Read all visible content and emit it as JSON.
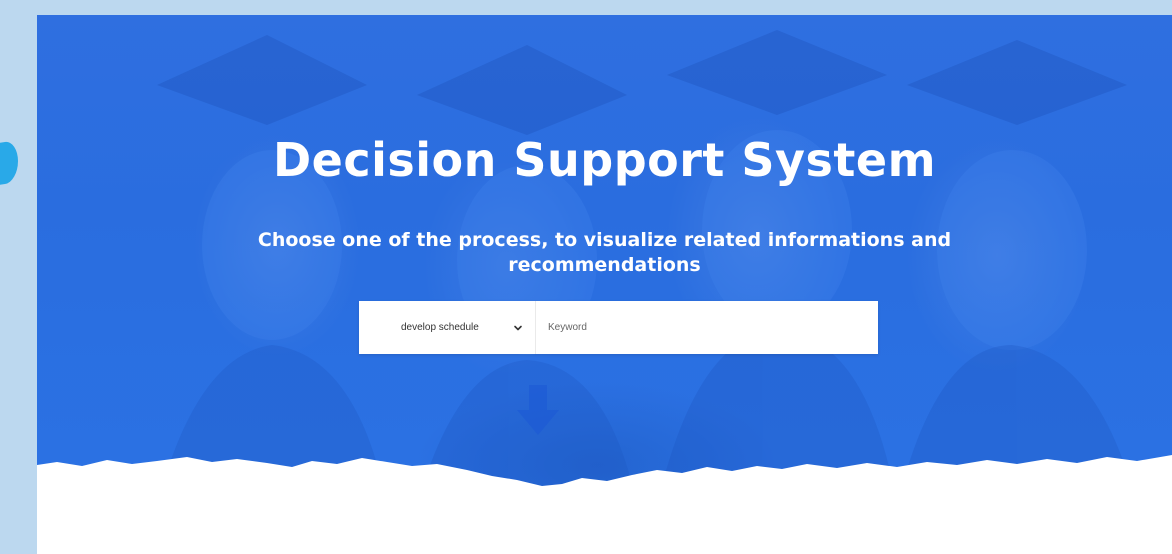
{
  "hero": {
    "title": "Decision Support System",
    "subtitle": "Choose one of the process, to visualize related informations and recommendations"
  },
  "search": {
    "process_select": {
      "selected": "develop schedule"
    },
    "keyword": {
      "placeholder": "Keyword",
      "value": ""
    }
  },
  "colors": {
    "hero_blue": "#2b6fe2",
    "page_background": "#bcd8ef",
    "side_accent": "#29a9e8",
    "text_white": "#ffffff"
  },
  "icons": {
    "select_chevron": "chevron-down-icon",
    "side_decor": "droplet-shape"
  }
}
